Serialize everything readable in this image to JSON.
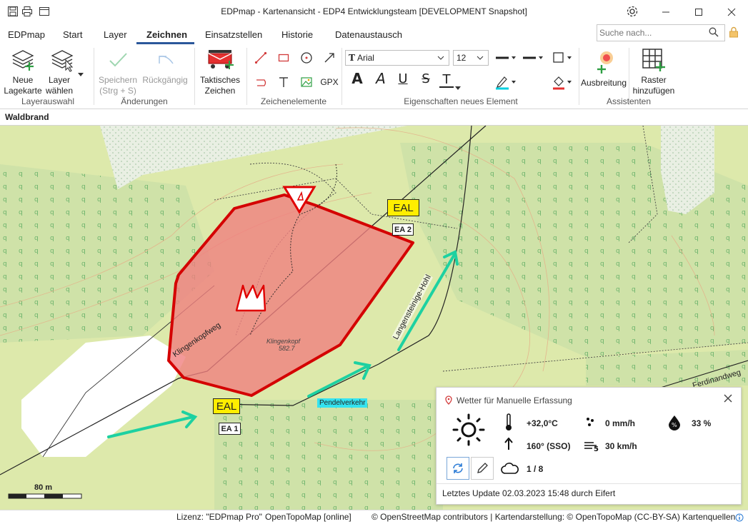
{
  "window": {
    "title": "EDPmap - Kartenansicht - EDP4 Entwicklungsteam  [DEVELOPMENT Snapshot]"
  },
  "menu": {
    "tabs": [
      "EDPmap",
      "Start",
      "Layer",
      "Zeichnen",
      "Einsatzstellen",
      "Historie",
      "Datenaustausch"
    ],
    "active_tab": "Zeichnen",
    "search_placeholder": "Suche nach..."
  },
  "ribbon": {
    "layerauswahl": {
      "new_map_label_1": "Neue",
      "new_map_label_2": "Lagekarte",
      "choose_layer_label_1": "Layer",
      "choose_layer_label_2": "wählen",
      "group": "Layerauswahl"
    },
    "aenderungen": {
      "save_label_1": "Speichern",
      "save_label_2": "(Strg + S)",
      "undo_label": "Rückgängig",
      "group": "Änderungen"
    },
    "taktisch": {
      "label_1": "Taktisches",
      "label_2": "Zeichen"
    },
    "zeichenelemente": {
      "gpx_label": "GPX",
      "text_tool": "T",
      "group": "Zeichenelemente"
    },
    "eigenschaften": {
      "font_name": "Arial",
      "font_size": "12",
      "group": "Eigenschaften neues Element",
      "bold_glyph": "A",
      "italic_glyph": "A",
      "underline_glyph": "U",
      "strike_glyph": "S",
      "color_glyph": "T"
    },
    "assistenten": {
      "spread_label": "Ausbreitung",
      "grid_label_1": "Raster",
      "grid_label_2": "hinzufügen",
      "group": "Assistenten"
    }
  },
  "document_tab": "Waldbrand",
  "map": {
    "labels": {
      "eal1": "EAL",
      "ea1": "EA 1",
      "eal2": "EAL",
      "ea2": "EA 2",
      "pendelverkehr": "Pendelverkehr",
      "klingenkopf": "Klingenkopf",
      "elevation": "582.7",
      "klingenkopfweg": "Klingenkopfweg",
      "langensteinige_hohl": "Langensteinige-Hohl",
      "ferdinandweg": "Ferdinandweg",
      "scale": "80 m"
    },
    "colors": {
      "fire_area_fill": "#f08080",
      "fire_area_stroke": "#d40000",
      "arrow": "#1dd1a1",
      "eal_box": "#ffee00"
    }
  },
  "weather": {
    "title": "Wetter für Manuelle Erfassung",
    "temperature": "+32,0°C",
    "precipitation": "0 mm/h",
    "humidity": "33 %",
    "wind_direction": "160° (SSO)",
    "wind_speed": "30 km/h",
    "cloud_cover": "1 / 8",
    "last_update": "Letztes Update 02.03.2023 15:48 durch Eifert"
  },
  "statusbar": {
    "license": "Lizenz: \"EDPmap Pro\"",
    "source": "OpenTopoMap [online]",
    "attribution": "© OpenStreetMap contributors | Kartendarstellung: © OpenTopoMap (CC-BY-SA) Kartenquellen"
  }
}
